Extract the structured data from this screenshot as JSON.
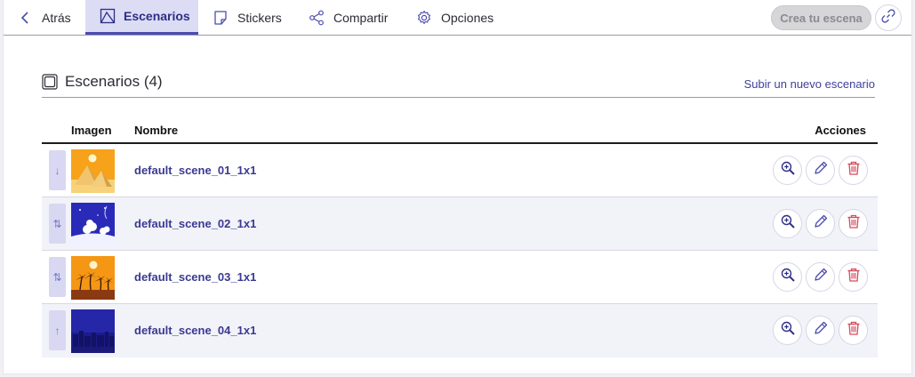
{
  "nav": {
    "back_label": "Atrás",
    "tabs": [
      {
        "label": "Escenarios",
        "icon": "scene-icon",
        "active": true
      },
      {
        "label": "Stickers",
        "icon": "sticker-icon"
      },
      {
        "label": "Compartir",
        "icon": "share-icon"
      },
      {
        "label": "Opciones",
        "icon": "gear-icon"
      }
    ],
    "create_label": "Crea tu escena",
    "link_icon": "link-icon"
  },
  "section": {
    "title": "Escenarios (4)",
    "upload_label": "Subir un nuevo escenario"
  },
  "table": {
    "headers": {
      "image": "Imagen",
      "name": "Nombre",
      "actions": "Acciones"
    },
    "rows": [
      {
        "name": "default_scene_01_1x1",
        "handle": "↓",
        "thumb": "desert-pyramids"
      },
      {
        "name": "default_scene_02_1x1",
        "handle": "⇅",
        "thumb": "night-snow"
      },
      {
        "name": "default_scene_03_1x1",
        "handle": "⇅",
        "thumb": "palm-sunset"
      },
      {
        "name": "default_scene_04_1x1",
        "handle": "↑",
        "thumb": "city-night"
      }
    ],
    "action_icons": [
      "zoom-icon",
      "pencil-icon",
      "trash-icon"
    ]
  },
  "colors": {
    "accent": "#4b4bb0",
    "active_tab_bg": "#dcdcf5",
    "link": "#3f3f9e",
    "delete": "#d64a5e"
  }
}
